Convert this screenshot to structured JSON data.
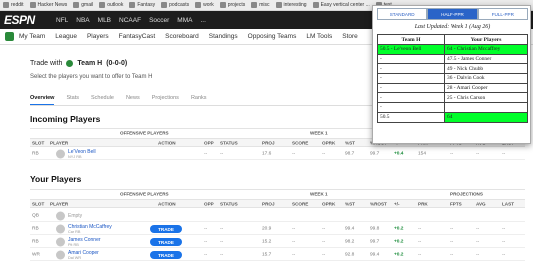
{
  "bookmarks": [
    "reddit",
    "Hacker News",
    "gmail",
    "outlook",
    "Fantasy",
    "podcasts",
    "work",
    "projects",
    "misc",
    "interesting",
    "Easy vertical center ...",
    "text"
  ],
  "espn": {
    "logo": "ESPN",
    "nav": [
      "NFL",
      "NBA",
      "MLB",
      "NCAAF",
      "Soccer",
      "MMA",
      "..."
    ]
  },
  "subnav": [
    "My Team",
    "League",
    "Players",
    "FantasyCast",
    "Scoreboard",
    "Standings",
    "Opposing Teams",
    "LM Tools",
    "Store"
  ],
  "trade": {
    "with_label": "Trade with",
    "team": "Team H",
    "record": "(0-0-0)",
    "subtitle": "Select the players you want to offer to Team H",
    "tabs": [
      "Overview",
      "Stats",
      "Schedule",
      "News",
      "Projections",
      "Ranks"
    ]
  },
  "incoming": {
    "title": "Incoming Players",
    "group_offense": "OFFENSIVE PLAYERS",
    "group_week": "WEEK 1",
    "columns": [
      "SLOT",
      "PLAYER",
      "ACTION",
      "OPP",
      "STATUS",
      "PROJ",
      "SCORE",
      "OPRK",
      "%ST",
      "%ROST",
      "+/-",
      "PRK",
      "FPTS",
      "AVG",
      "LAST"
    ],
    "rows": [
      {
        "slot": "RB",
        "name": "Le'Veon Bell",
        "team": "NYJ RB",
        "opp": "--",
        "status": "--",
        "proj": "17.6",
        "score": "--",
        "oprk": "--",
        "st": "98.7",
        "rost": "99.7",
        "pm": "+0.4",
        "prk": "154",
        "fpts": "--",
        "avg": "--",
        "last": "--"
      }
    ]
  },
  "yours": {
    "title": "Your Players",
    "group_offense": "OFFENSIVE PLAYERS",
    "group_week": "WEEK 1",
    "group_proj": "PROJECTIONS",
    "columns": [
      "SLOT",
      "PLAYER",
      "ACTION",
      "OPP",
      "STATUS",
      "PROJ",
      "SCORE",
      "OPRK",
      "%ST",
      "%ROST",
      "+/-",
      "PRK",
      "FPTS",
      "AVG",
      "LAST"
    ],
    "rows": [
      {
        "slot": "QB",
        "name": "Empty",
        "team": "",
        "action": "",
        "opp": "",
        "status": "",
        "proj": "",
        "score": "",
        "oprk": "",
        "st": "",
        "rost": "",
        "pm": "",
        "prk": "",
        "fpts": "",
        "avg": "",
        "last": ""
      },
      {
        "slot": "RB",
        "name": "Christian McCaffrey",
        "team": "Car RB",
        "action": "TRADE",
        "opp": "--",
        "status": "--",
        "proj": "20.9",
        "score": "--",
        "oprk": "--",
        "st": "99.4",
        "rost": "99.8",
        "pm": "+0.2",
        "prk": "--",
        "fpts": "--",
        "avg": "--",
        "last": "--"
      },
      {
        "slot": "RB",
        "name": "James Conner",
        "team": "Pit RB",
        "action": "TRADE",
        "opp": "--",
        "status": "--",
        "proj": "15.2",
        "score": "--",
        "oprk": "--",
        "st": "98.2",
        "rost": "99.7",
        "pm": "+0.2",
        "prk": "--",
        "fpts": "--",
        "avg": "--",
        "last": "--"
      },
      {
        "slot": "WR",
        "name": "Amari Cooper",
        "team": "Dal WR",
        "action": "TRADE",
        "opp": "--",
        "status": "--",
        "proj": "15.7",
        "score": "--",
        "oprk": "--",
        "st": "92.8",
        "rost": "99.4",
        "pm": "+0.2",
        "prk": "--",
        "fpts": "--",
        "avg": "--",
        "last": "--"
      }
    ]
  },
  "popup": {
    "tabs": [
      "STANDARD",
      "HALF-PPR",
      "FULL-PPR"
    ],
    "selected_tab": "HALF-PPR",
    "updated": "Last Updated: Week 1 (Aug 26)",
    "col_a": "Team H",
    "col_b": "Your Players",
    "rows": [
      {
        "a": "50.5 - Le'veon Bell",
        "b": "64 - Christian Mccaffrey",
        "highlight": true
      },
      {
        "a": "-",
        "b": "47.5 - James Conner",
        "highlight": false
      },
      {
        "a": "-",
        "b": "49 - Nick Chubb",
        "highlight": false
      },
      {
        "a": "-",
        "b": "36 - Dalvin Cook",
        "highlight": false
      },
      {
        "a": "-",
        "b": "28 - Amari Cooper",
        "highlight": false
      },
      {
        "a": "-",
        "b": "25 - Chris Carson",
        "highlight": false
      },
      {
        "a": "-",
        "b": "",
        "highlight": false
      }
    ],
    "total_a": "50.5",
    "total_b": "64",
    "highlight_color": "#00ff2a"
  }
}
